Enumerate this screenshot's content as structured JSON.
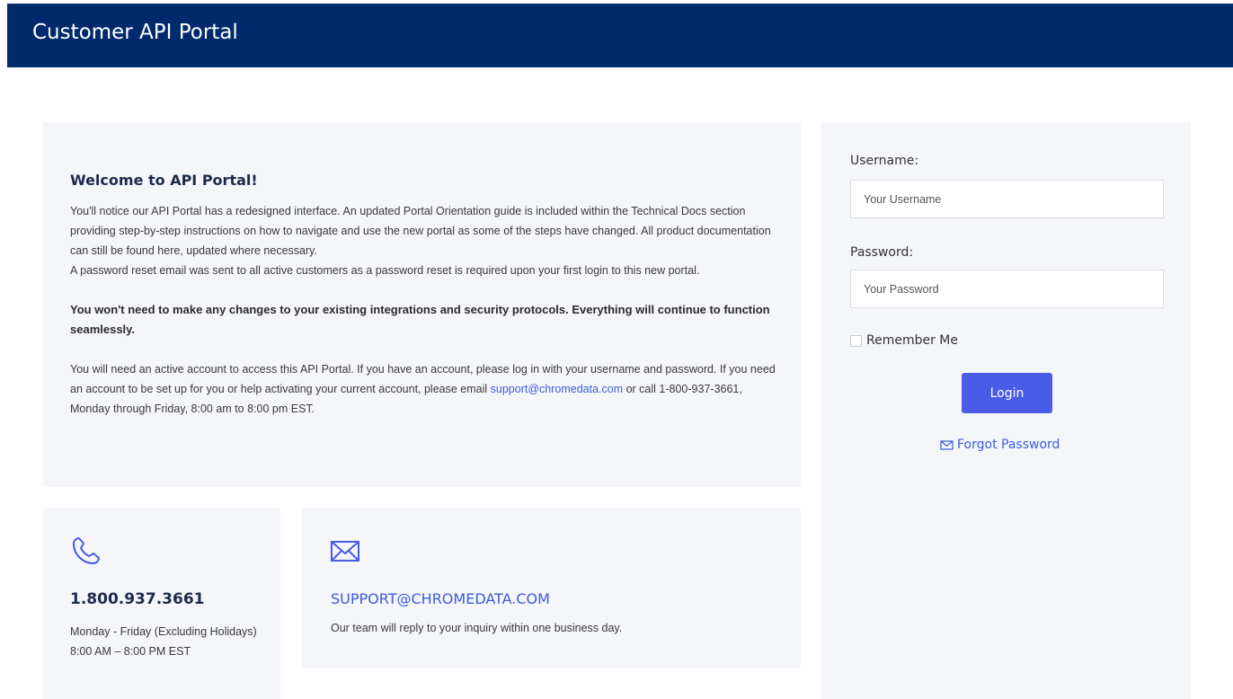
{
  "header": {
    "title": "Customer API Portal"
  },
  "welcome": {
    "title": "Welcome to API Portal!",
    "paragraph1": "You'll notice our API Portal has a redesigned interface. An updated Portal Orientation guide is included within the Technical Docs section providing step-by-step instructions on how to navigate and use the new portal as some of the steps have changed. All product documentation can still be found here, updated where necessary.",
    "paragraph2": "A password reset email was sent to all active customers as a password reset is required upon your first login to this new portal.",
    "bold_note": "You won't need to make any changes to your existing integrations and security protocols. Everything will continue to function seamlessly.",
    "paragraph3_before": "You will need an active account to access this API Portal. If you have an account, please log in with your username and password. If you need an account to be set up for you or help activating your current account, please email ",
    "support_email": "support@chromedata.com",
    "paragraph3_after": " or call 1-800-937-3661, Monday through Friday, 8:00 am to 8:00 pm EST."
  },
  "phone_card": {
    "icon": "phone-icon",
    "number": "1.800.937.3661",
    "hours_line1": "Monday - Friday (Excluding Holidays)",
    "hours_line2": "8:00 AM – 8:00 PM EST"
  },
  "mail_card": {
    "icon": "envelope-icon",
    "address": "SUPPORT@CHROMEDATA.COM",
    "text": "Our team will reply to your inquiry within one business day."
  },
  "login": {
    "username_label": "Username:",
    "username_placeholder": "Your Username",
    "password_label": "Password:",
    "password_placeholder": "Your Password",
    "remember_label": "Remember Me",
    "login_button": "Login",
    "forgot_label": "Forgot Password",
    "forgot_icon": "envelope-icon"
  },
  "colors": {
    "header_bg": "#002a6c",
    "accent": "#4a5be8",
    "link": "#3b5bdb",
    "panel_bg": "#f5f6fa"
  }
}
